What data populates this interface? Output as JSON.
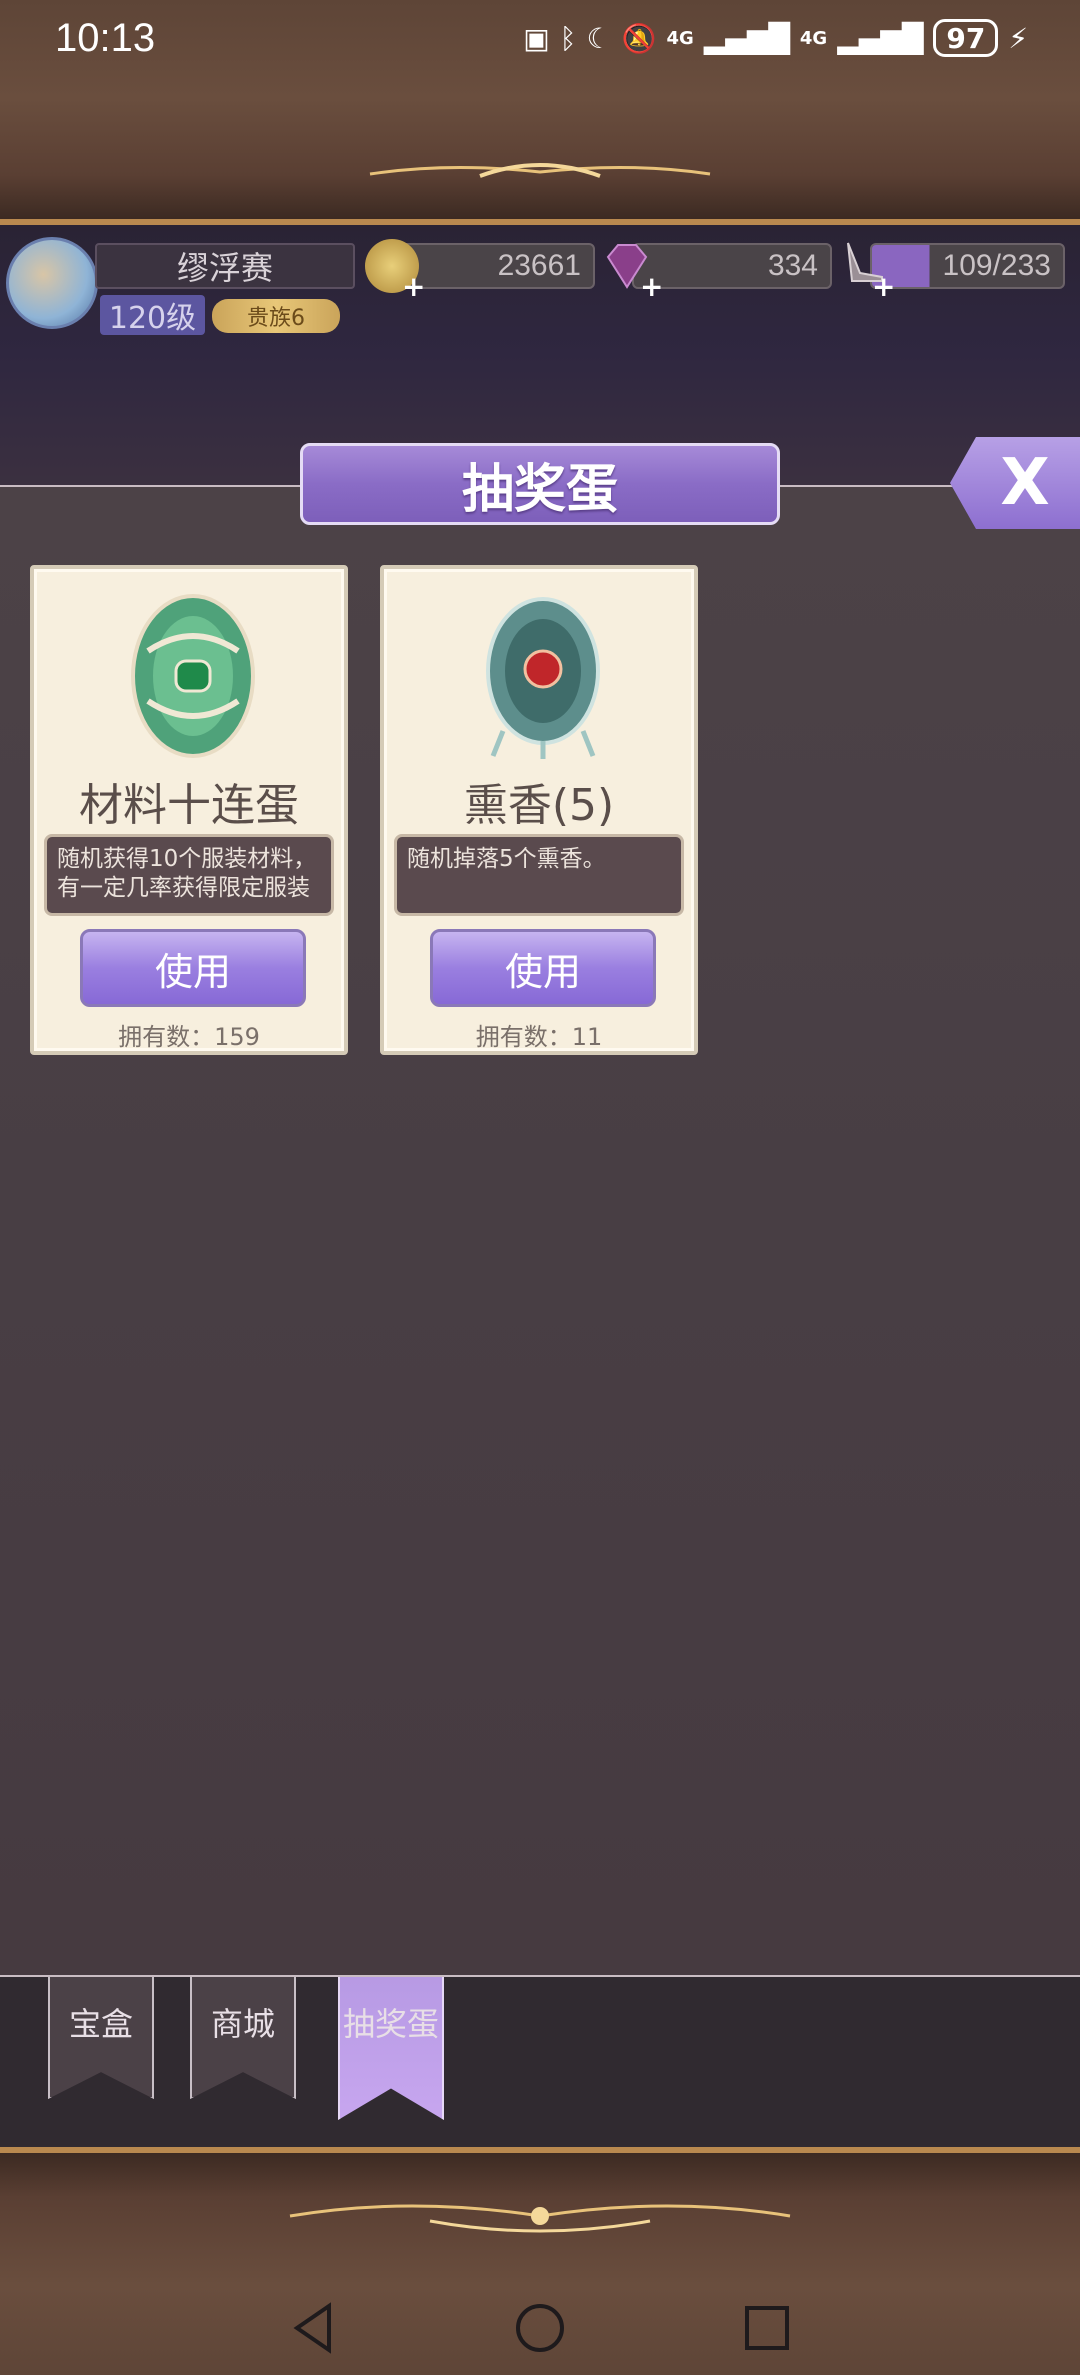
{
  "status_bar": {
    "time": "10:13",
    "network_1": "4G",
    "network_2": "4G",
    "battery": "97"
  },
  "player": {
    "name": "缪浮赛",
    "level": "120级",
    "vip": "贵族6"
  },
  "resources": {
    "gold": "23661",
    "gems": "334",
    "stamina": "109/233"
  },
  "panel": {
    "title": "抽奖蛋",
    "close_label": "X"
  },
  "cards": [
    {
      "title": "材料十连蛋",
      "description": "随机获得10个服装材料，有一定几率获得限定服装",
      "button": "使用",
      "owned": "拥有数：159",
      "icon": "green-egg-icon"
    },
    {
      "title": "熏香(5)",
      "description": "随机掉落5个熏香。",
      "button": "使用",
      "owned": "拥有数：11",
      "icon": "rose-egg-icon"
    }
  ],
  "tabs": [
    {
      "label": "宝盒",
      "active": false
    },
    {
      "label": "商城",
      "active": false
    },
    {
      "label": "抽奖蛋",
      "active": true
    }
  ],
  "colors": {
    "accent_purple": "#9a7fe0",
    "panel_bg": "#483e44",
    "frame_brown": "#6a4e3e",
    "card_bg": "#f7efde"
  }
}
